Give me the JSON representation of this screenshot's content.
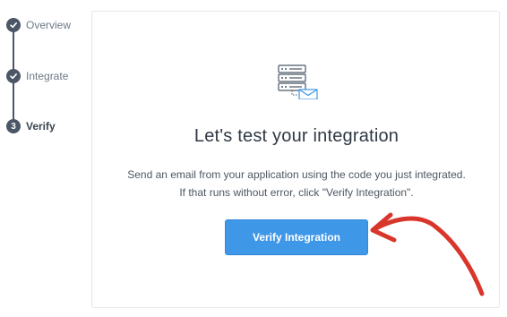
{
  "steps": [
    {
      "number": "",
      "label": "Overview",
      "state": "done"
    },
    {
      "number": "",
      "label": "Integrate",
      "state": "done"
    },
    {
      "number": "3",
      "label": "Verify",
      "state": "active"
    }
  ],
  "card": {
    "icon": "server-email-icon",
    "title": "Let's test your integration",
    "description": "Send an email from your application using the code you just integrated. If that runs without error, click \"Verify Integration\".",
    "button_label": "Verify Integration"
  },
  "annotation": {
    "icon": "red-arrow-icon",
    "color": "#d9362b"
  },
  "colors": {
    "accent": "#3f97e8",
    "stepper": "#4b5766"
  }
}
